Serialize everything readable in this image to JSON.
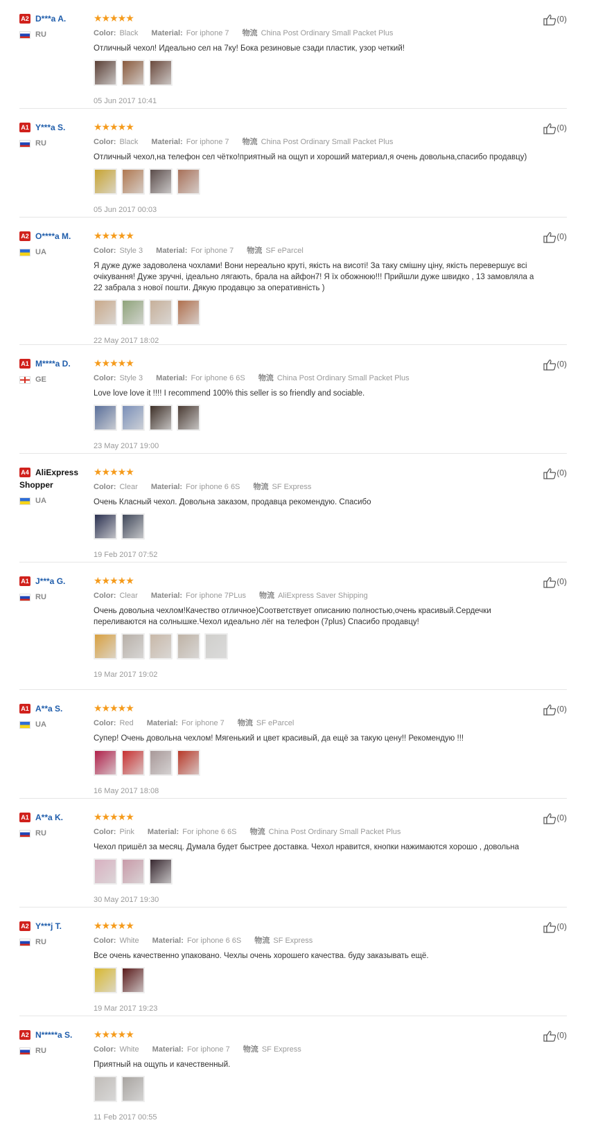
{
  "labels": {
    "color": "Color:",
    "material": "Material:",
    "shipping_prefix": "物流"
  },
  "reviews": [
    {
      "level": "A2",
      "name": "D***a A.",
      "country": "RU",
      "flag": "ru",
      "stars": "★★★★★",
      "color": "Black",
      "material": "For iphone 7",
      "shipping": "China Post Ordinary Small Packet Plus",
      "text": "Отличный чехол! Идеально сел на 7ку! Бока резиновые сзади пластик, узор четкий!",
      "photos": [
        "#5a3f35",
        "#8a5a3c",
        "#6b4a3d"
      ],
      "date": "05 Jun 2017 10:41",
      "likes": "(0)"
    },
    {
      "level": "A1",
      "name": "Y***a S.",
      "country": "RU",
      "flag": "ru",
      "stars": "★★★★★",
      "color": "Black",
      "material": "For iphone 7",
      "shipping": "China Post Ordinary Small Packet Plus",
      "text": "Отличный чехол,на телефон сел чётко!приятный на ощуп и хороший материал,я очень довольна,спасибо продавцу)",
      "photos": [
        "#c8a432",
        "#b07850",
        "#5b4c4a",
        "#a87058"
      ],
      "date": "05 Jun 2017 00:03",
      "likes": "(0)"
    },
    {
      "level": "A2",
      "name": "O****a M.",
      "country": "UA",
      "flag": "ua",
      "stars": "★★★★★",
      "color": "Style 3",
      "material": "For iphone 7",
      "shipping": "SF eParcel",
      "text": "Я дуже дуже задоволена чохлами! Вони нереально круті, якість на висоті! За таку смішну ціну, якість перевершує всі очікування! Дуже зручні, ідеально лягають, брала на айфон7! Я їх обожнюю!!! Прийшли дуже швидко , 13 замовляла а 22 забрала з нової пошти. Дякую продавцю за оперативність )",
      "photos": [
        "#c9a98a",
        "#8fa37a",
        "#c7b09a",
        "#b0704e"
      ],
      "date": "22 May 2017 18:02",
      "likes": "(0)"
    },
    {
      "level": "A1",
      "name": "M****a D.",
      "country": "GE",
      "flag": "ge",
      "stars": "★★★★★",
      "color": "Style 3",
      "material": "For iphone 6 6S",
      "shipping": "China Post Ordinary Small Packet Plus",
      "text": "Love love love it !!!! I recommend 100% this seller is so friendly and sociable.",
      "photos": [
        "#5a6f9a",
        "#7a8fb8",
        "#3e3028",
        "#4a3b33"
      ],
      "date": "23 May 2017 19:00",
      "likes": "(0)"
    },
    {
      "level": "A4",
      "name": "AliExpress Shopper",
      "dark": true,
      "country": "UA",
      "flag": "ua",
      "stars": "★★★★★",
      "color": "Clear",
      "material": "For iphone 6 6S",
      "shipping": "SF Express",
      "text": "Очень Класный чехол. Довольна заказом, продавца рекомендую. Спасибо",
      "photos": [
        "#2a3050",
        "#40485a"
      ],
      "date": "19 Feb 2017 07:52",
      "likes": "(0)"
    },
    {
      "level": "A1",
      "name": "J***a G.",
      "country": "RU",
      "flag": "ru",
      "stars": "★★★★★",
      "color": "Clear",
      "material": "For iphone 7PLus",
      "shipping": "AliExpress Saver Shipping",
      "text": "Очень довольна чехлом!Качество отличное)Соответствует описанию полностью,очень красивый.Сердечки переливаются на солнышке.Чехол идеально лёг на телефон (7plus) Спасибо продавцу!",
      "photos": [
        "#d8a040",
        "#b8b0a8",
        "#c8b8a8",
        "#bfb3a6",
        "#d0cfcc"
      ],
      "date": "19 Mar 2017 19:02",
      "likes": "(0)"
    },
    {
      "level": "A1",
      "name": "A**a S.",
      "country": "UA",
      "flag": "ua",
      "stars": "★★★★★",
      "color": "Red",
      "material": "For iphone 7",
      "shipping": "SF eParcel",
      "text": "Супер! Очень довольна чехлом! Мягенький и цвет красивый, да ещё за такую цену!! Рекомендую !!!",
      "photos": [
        "#b0204a",
        "#c83030",
        "#a89898",
        "#b83828"
      ],
      "date": "16 May 2017 18:08",
      "likes": "(0)"
    },
    {
      "level": "A1",
      "name": "A**a K.",
      "country": "RU",
      "flag": "ru",
      "stars": "★★★★★",
      "color": "Pink",
      "material": "For iphone 6 6S",
      "shipping": "China Post Ordinary Small Packet Plus",
      "text": "Чехол пришёл за месяц. Думала будет быстрее доставка. Чехол нравится, кнопки нажимаются хорошо , довольна",
      "photos": [
        "#d8b0c0",
        "#c89aa8",
        "#382830"
      ],
      "date": "30 May 2017 19:30",
      "likes": "(0)"
    },
    {
      "level": "A2",
      "name": "Y***j T.",
      "country": "RU",
      "flag": "ru",
      "stars": "★★★★★",
      "color": "White",
      "material": "For iphone 6 6S",
      "shipping": "SF Express",
      "text": "Все очень качественно упаковано. Чехлы очень хорошего качества. буду заказывать ещё.",
      "photos": [
        "#d8b830",
        "#5a1a1a"
      ],
      "date": "19 Mar 2017 19:23",
      "likes": "(0)"
    },
    {
      "level": "A2",
      "name": "N*****a S.",
      "country": "RU",
      "flag": "ru",
      "stars": "★★★★★",
      "color": "White",
      "material": "For iphone 7",
      "shipping": "SF Express",
      "text": "Приятный на ощупь и качественный.",
      "photos": [
        "#c0bcb8",
        "#a8a4a0"
      ],
      "date": "11 Feb 2017 00:55",
      "likes": "(0)"
    }
  ]
}
